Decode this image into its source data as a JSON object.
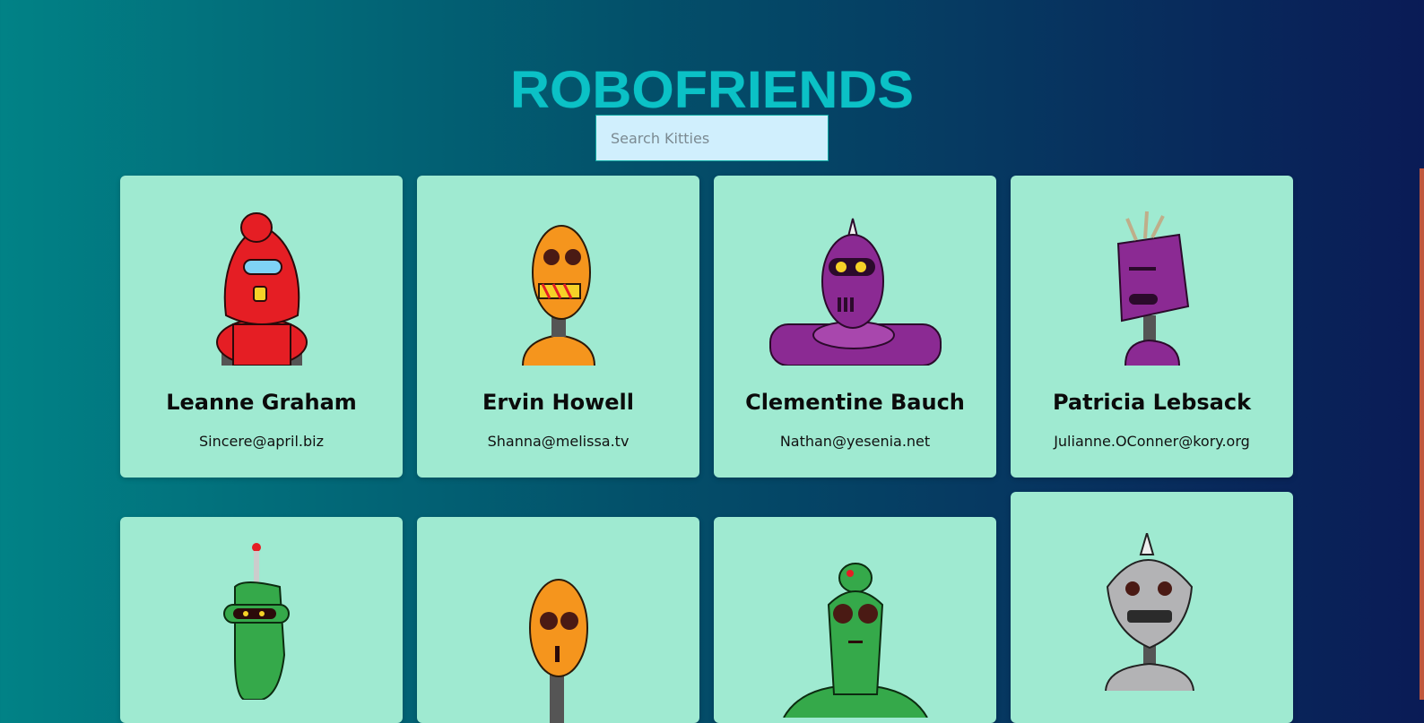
{
  "header": {
    "title": "ROBOFRIENDS"
  },
  "search": {
    "placeholder": "Search Kitties",
    "value": ""
  },
  "cards": [
    {
      "name": "Leanne Graham",
      "email": "Sincere@april.biz",
      "robot_color": "#e51e24"
    },
    {
      "name": "Ervin Howell",
      "email": "Shanna@melissa.tv",
      "robot_color": "#f5951d"
    },
    {
      "name": "Clementine Bauch",
      "email": "Nathan@yesenia.net",
      "robot_color": "#8b2a93"
    },
    {
      "name": "Patricia Lebsack",
      "email": "Julianne.OConner@kory.org",
      "robot_color": "#8b2a93"
    },
    {
      "name": "",
      "email": "",
      "robot_color": "#35a94a"
    },
    {
      "name": "",
      "email": "",
      "robot_color": "#f5951d"
    },
    {
      "name": "",
      "email": "",
      "robot_color": "#35a94a"
    },
    {
      "name": "",
      "email": "",
      "robot_color": "#b3b3b5"
    }
  ],
  "colors": {
    "title": "#0bc1c6",
    "card_bg": "#9fead1",
    "search_bg": "#d0effd"
  }
}
